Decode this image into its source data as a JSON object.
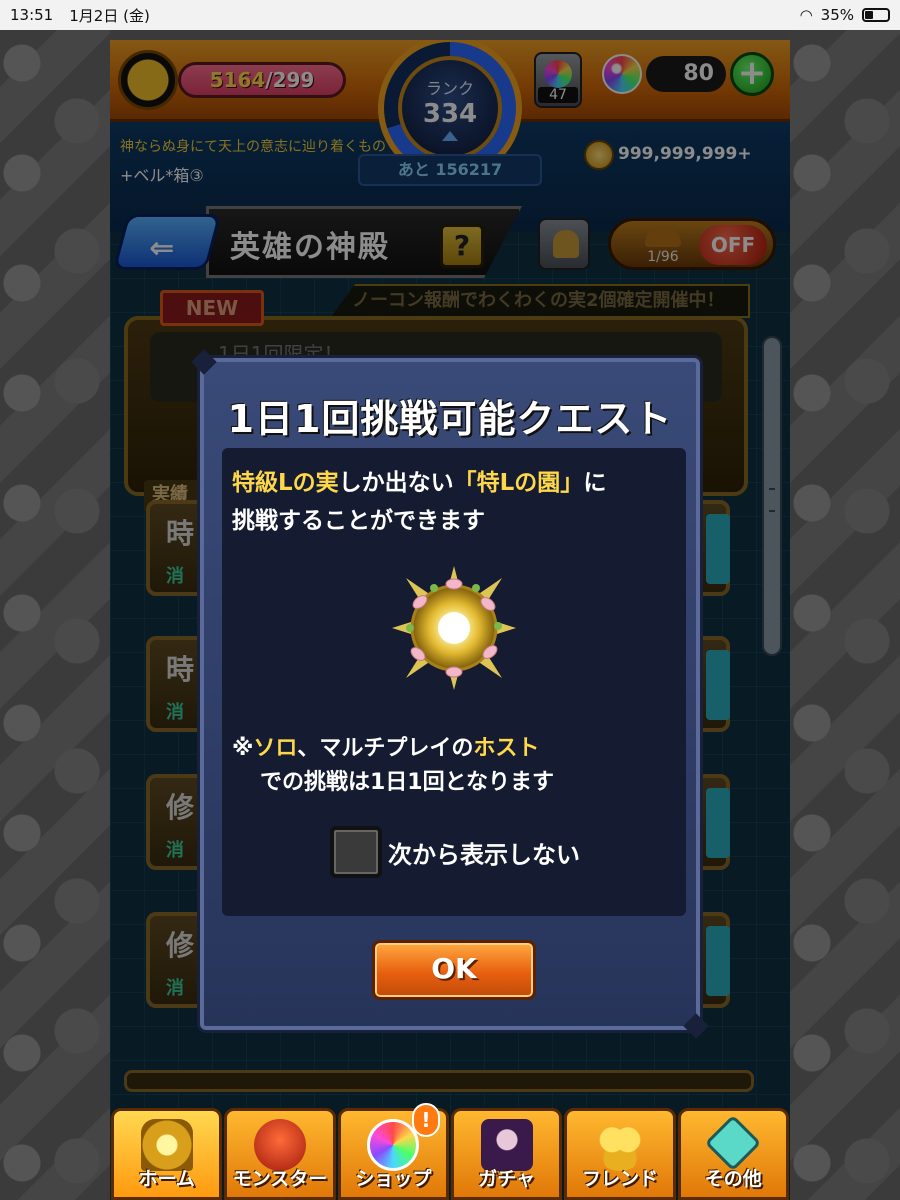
{
  "status_bar": {
    "time": "13:51",
    "date": "1月2日 (金)",
    "battery": "35%"
  },
  "header": {
    "stamina_current": "5164",
    "stamina_max": "/299",
    "rank_label": "ランク",
    "rank_value": "334",
    "rank_next": "あと 156217",
    "orb_box_count": "47",
    "orb_count": "80",
    "player_title": "神ならぬ身にて天上の意志に辿り着くもの",
    "bell_text": "+ベル*箱③",
    "coins": "999,999,999+"
  },
  "nav": {
    "title": "英雄の神殿",
    "help": "?",
    "auto_counter": "1/96",
    "auto_state": "OFF"
  },
  "background": {
    "new_tag": "NEW",
    "banner": "ノーコン報酬でわくわくの実2個確定開催中！",
    "card_title": "1日1回限定！",
    "label_tag": "実績",
    "rows": [
      {
        "big": "時",
        "small": "消"
      },
      {
        "big": "時",
        "small": "消"
      },
      {
        "big": "修",
        "small": "消"
      },
      {
        "big": "修",
        "small": "消"
      }
    ]
  },
  "modal": {
    "title": "1日1回挑戦可能クエスト",
    "desc_part1": "特級Lの実",
    "desc_part2": "しか出ない",
    "desc_part3": "「特Lの園」",
    "desc_part4": "に",
    "desc_line2": "挑戦することができます",
    "note_prefix": "※",
    "note_hl1": "ソロ",
    "note_mid": "、マルチプレイの",
    "note_hl2": "ホスト",
    "note_line2": "での挑戦は1日1回となります",
    "checkbox_label": "次から表示しない",
    "ok": "OK"
  },
  "tabs": [
    {
      "label": "ホーム",
      "icon": "home-gate-icon"
    },
    {
      "label": "モンスター",
      "icon": "monster-icon"
    },
    {
      "label": "ショップ",
      "icon": "orb-icon",
      "badge": "!"
    },
    {
      "label": "ガチャ",
      "icon": "gacha-character-icon"
    },
    {
      "label": "フレンド",
      "icon": "friend-icon"
    },
    {
      "label": "その他",
      "icon": "other-icon"
    }
  ]
}
